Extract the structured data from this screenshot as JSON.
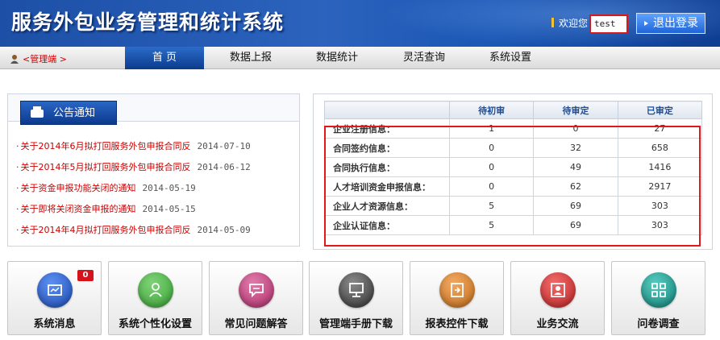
{
  "header": {
    "title": "服务外包业务管理和统计系统",
    "welcome": "欢迎您",
    "username": "test",
    "logout_label": "退出登录"
  },
  "nav": {
    "admin_label": "<管理端 >",
    "items": [
      {
        "label": "首 页"
      },
      {
        "label": "数据上报"
      },
      {
        "label": "数据统计"
      },
      {
        "label": "灵活查询"
      },
      {
        "label": "系统设置"
      }
    ]
  },
  "notice": {
    "tab_label": "公告通知",
    "items": [
      {
        "title": "关于2014年6月拟打回服务外包申报合同反",
        "date": "2014-07-10"
      },
      {
        "title": "关于2014年5月拟打回服务外包申报合同反",
        "date": "2014-06-12"
      },
      {
        "title": "关于资金申报功能关闭的通知",
        "date": "2014-05-19"
      },
      {
        "title": "关于即将关闭资金申报的通知",
        "date": "2014-05-15"
      },
      {
        "title": "关于2014年4月拟打回服务外包申报合同反",
        "date": "2014-05-09"
      }
    ]
  },
  "stats": {
    "columns": [
      "",
      "待初审",
      "待审定",
      "已审定"
    ],
    "rows": [
      {
        "label": "企业注册信息：",
        "pending_initial": "1",
        "pending_final": "0",
        "approved": "27"
      },
      {
        "label": "合同签约信息：",
        "pending_initial": "0",
        "pending_final": "32",
        "approved": "658"
      },
      {
        "label": "合同执行信息：",
        "pending_initial": "0",
        "pending_final": "49",
        "approved": "1416"
      },
      {
        "label": "人才培训资金申报信息：",
        "pending_initial": "0",
        "pending_final": "62",
        "approved": "2917"
      },
      {
        "label": "企业人才资源信息：",
        "pending_initial": "5",
        "pending_final": "69",
        "approved": "303"
      },
      {
        "label": "企业认证信息：",
        "pending_initial": "5",
        "pending_final": "69",
        "approved": "303"
      }
    ]
  },
  "tiles": [
    {
      "label": "系统消息",
      "icon": "message-icon",
      "color": "#1f4fb8",
      "badge": "0"
    },
    {
      "label": "系统个性化设置",
      "icon": "user-settings-icon",
      "color": "#3aa336"
    },
    {
      "label": "常见问题解答",
      "icon": "faq-icon",
      "color": "#b0306e"
    },
    {
      "label": "管理端手册下载",
      "icon": "manual-download-icon",
      "color": "#444444"
    },
    {
      "label": "报表控件下载",
      "icon": "report-control-icon",
      "color": "#c4701c"
    },
    {
      "label": "业务交流",
      "icon": "exchange-icon",
      "color": "#c02626"
    },
    {
      "label": "问卷调查",
      "icon": "survey-icon",
      "color": "#14857c"
    }
  ]
}
